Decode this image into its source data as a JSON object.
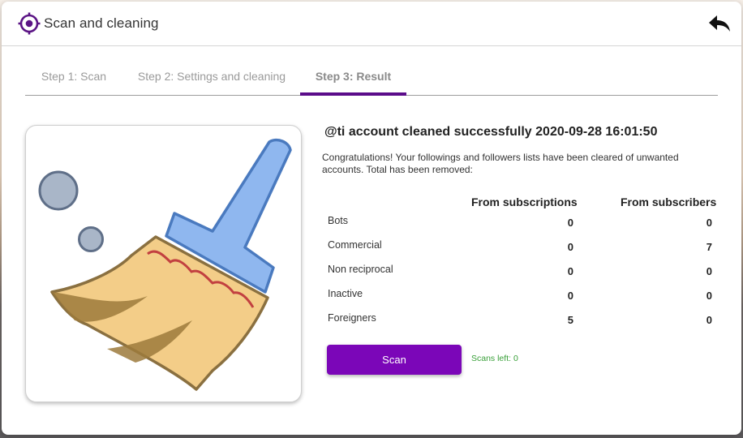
{
  "window": {
    "title": "Scan and cleaning",
    "app_icon": "crosshair-target-icon",
    "back_icon": "undo-arrow-icon"
  },
  "tabs": [
    {
      "label": "Step 1: Scan",
      "active": false
    },
    {
      "label": "Step 2: Settings and cleaning",
      "active": false
    },
    {
      "label": "Step 3: Result",
      "active": true
    }
  ],
  "illustration": "broom-icon",
  "result": {
    "title": "@ti account cleaned successfully 2020-09-28 16:01:50",
    "message": "Congratulations! Your followings and followers lists have been cleared of unwanted accounts. Total has been removed:"
  },
  "table": {
    "columns": [
      "From subscriptions",
      "From subscribers"
    ],
    "rows": [
      {
        "label": "Bots",
        "subscriptions": "0",
        "subscribers": "0"
      },
      {
        "label": "Commercial",
        "subscriptions": "0",
        "subscribers": "7"
      },
      {
        "label": "Non reciprocal",
        "subscriptions": "0",
        "subscribers": "0"
      },
      {
        "label": "Inactive",
        "subscriptions": "0",
        "subscribers": "0"
      },
      {
        "label": "Foreigners",
        "subscriptions": "5",
        "subscribers": "0"
      }
    ]
  },
  "actions": {
    "scan_label": "Scan",
    "scans_left": "Scans left: 0"
  },
  "colors": {
    "accent": "#7b06b8",
    "tab_indicator": "#5b0c8a",
    "scans_left": "#3aa03a"
  }
}
